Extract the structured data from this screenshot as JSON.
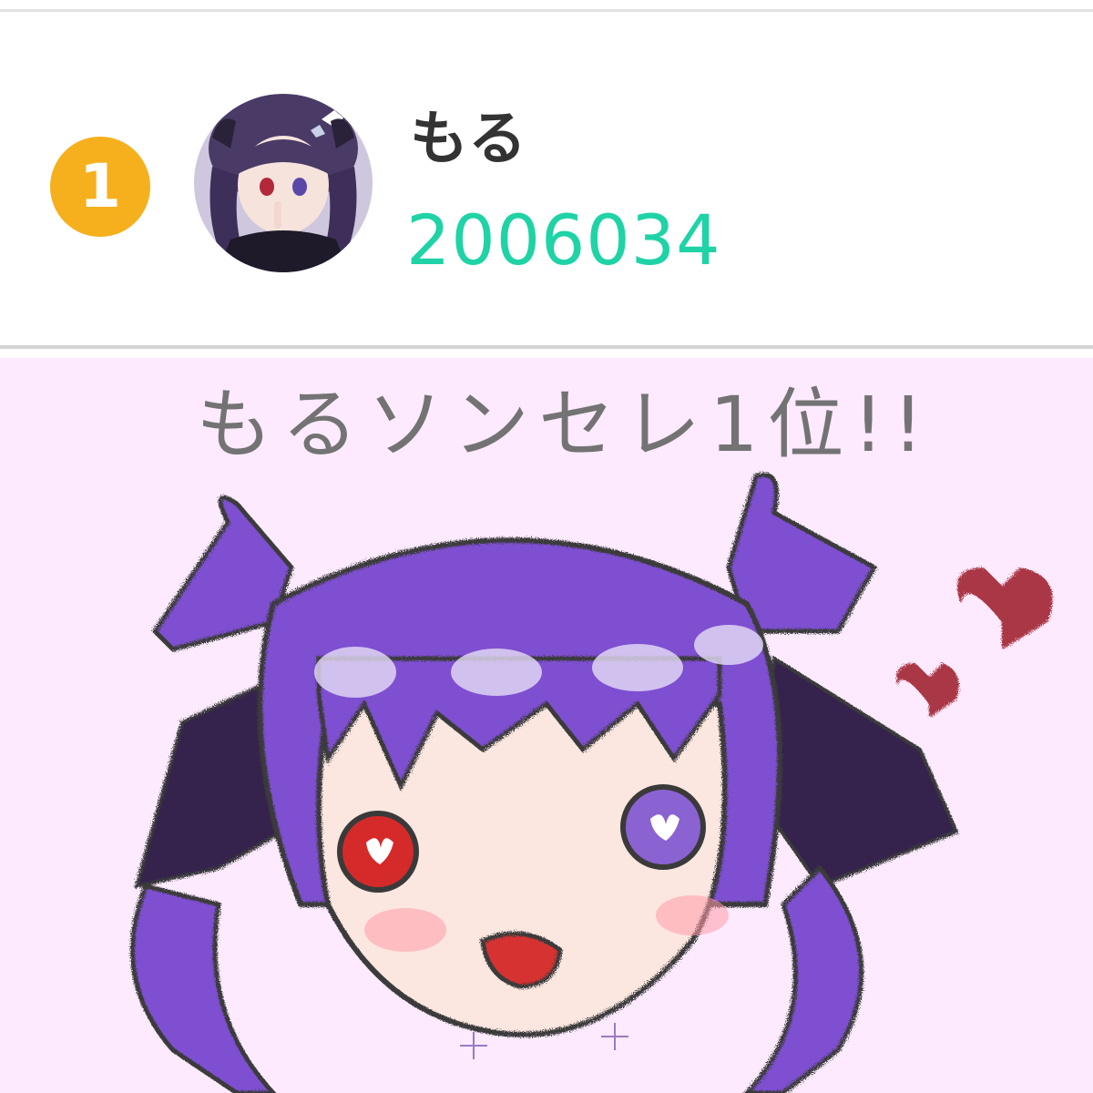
{
  "ranking": {
    "rank": "1",
    "badge_color": "#f6b01e",
    "avatar_icon": "user-avatar-icon",
    "user_name": "もる",
    "score": "2006034",
    "score_color": "#1fd3a6"
  },
  "artwork": {
    "caption": "もるソンセレ1位!!",
    "background_color": "#fdeaff",
    "hair_color": "#7e4fd0",
    "heart_color": "#9b1a24"
  }
}
